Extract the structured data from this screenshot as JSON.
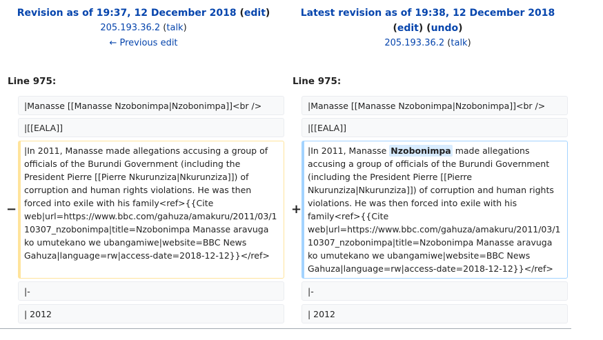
{
  "left_header": {
    "title_prefix": "Revision as of 19:37, 12 December 2018",
    "edit_label": "edit",
    "user_ip": "205.193.36.2",
    "talk_label": "talk",
    "previous_edit": "← Previous edit"
  },
  "right_header": {
    "title": "Latest revision as of 19:38, 12 December 2018",
    "edit_label": "edit",
    "undo_label": "undo",
    "user_ip": "205.193.36.2",
    "talk_label": "talk"
  },
  "line_numbers": {
    "left": "Line 975:",
    "right": "Line 975:"
  },
  "markers": {
    "removed": "−",
    "added": "+"
  },
  "context_rows": [
    "|Manasse [[Manasse Nzobonimpa|Nzobonimpa]]<br />",
    "|[[EALA]]",
    "|-",
    "| 2012"
  ],
  "changed_row": {
    "old_text": "|In 2011, Manasse made allegations accusing a group of officials of the Burundi Government (including the President Pierre [[Pierre Nkurunziza|Nkurunziza]]) of corruption and human rights violations. He was then forced into exile with his family<ref>{{Cite web|url=https://www.bbc.com/gahuza/amakuru/2011/03/110307_nzobonimpa|title=Nzobonimpa Manasse aravuga ko umutekano we ubangamiwe|website=BBC News Gahuza|language=rw|access-date=2018-12-12}}</ref>",
    "new_text_before": "|In 2011, Manasse ",
    "new_inserted_word": "Nzobonimpa",
    "new_text_after": " made allegations accusing a group of officials of the Burundi Government (including the President Pierre [[Pierre Nkurunziza|Nkurunziza]]) of corruption and human rights violations. He was then forced into exile with his family<ref>{{Cite web|url=https://www.bbc.com/gahuza/amakuru/2011/03/110307_nzobonimpa|title=Nzobonimpa Manasse aravuga ko umutekano we ubangamiwe|website=BBC News Gahuza|language=rw|access-date=2018-12-12}}</ref>"
  }
}
